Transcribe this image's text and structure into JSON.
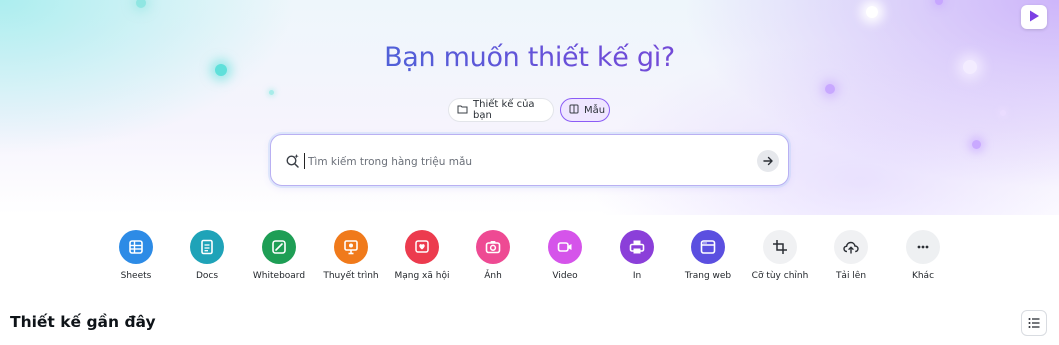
{
  "hero": {
    "title": "Bạn muốn thiết kế gì?",
    "toggles": [
      {
        "label": "Thiết kế của bạn",
        "icon": "folder-icon",
        "selected": false
      },
      {
        "label": "Mẫu",
        "icon": "template-icon",
        "selected": true
      }
    ]
  },
  "search": {
    "placeholder": "Tìm kiếm trong hàng triệu mẫu",
    "value": ""
  },
  "categories": [
    {
      "label": "Sheets",
      "icon": "sheets-icon",
      "color": "#2d8be6"
    },
    {
      "label": "Docs",
      "icon": "docs-icon",
      "color": "#1fa3b8"
    },
    {
      "label": "Whiteboard",
      "icon": "whiteboard-icon",
      "color": "#1e9e55"
    },
    {
      "label": "Thuyết trình",
      "icon": "presentation-icon",
      "color": "#f07a1b"
    },
    {
      "label": "Mạng xã hội",
      "icon": "social-heart-icon",
      "color": "#ec3b4e"
    },
    {
      "label": "Ảnh",
      "icon": "camera-icon",
      "color": "#ee4a93"
    },
    {
      "label": "Video",
      "icon": "video-icon",
      "color": "#d554ea"
    },
    {
      "label": "In",
      "icon": "printer-icon",
      "color": "#8b3fd9"
    },
    {
      "label": "Trang web",
      "icon": "website-icon",
      "color": "#5b4fe0"
    },
    {
      "label": "Cỡ tùy chỉnh",
      "icon": "custom-size-icon",
      "color": "#f0f1f3"
    },
    {
      "label": "Tải lên",
      "icon": "upload-cloud-icon",
      "color": "#f0f1f3"
    },
    {
      "label": "Khác",
      "icon": "more-icon",
      "color": "#eef0f2"
    }
  ],
  "recent": {
    "title": "Thiết kế gần đây"
  },
  "colors": {
    "accent": "#8b5cf6",
    "title_gradient_start": "#3a6fd6",
    "title_gradient_end": "#8a3fd2"
  }
}
